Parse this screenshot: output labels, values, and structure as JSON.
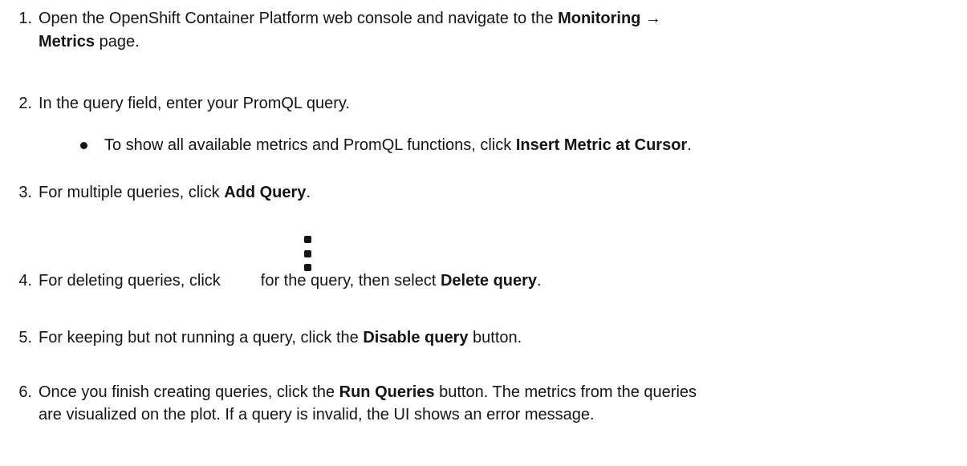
{
  "steps": [
    {
      "number": "1.",
      "pre": "Open the OpenShift Container Platform web console and navigate to the ",
      "bold": "Monitoring →",
      "line2_bold": "Metrics",
      "line2_post": " page."
    },
    {
      "number": "2.",
      "text": "In the query field, enter your PromQL query.",
      "bullet": {
        "pre": "To show all available metrics and PromQL functions, click ",
        "bold": "Insert Metric at Cursor",
        "post": "."
      }
    },
    {
      "number": "3.",
      "pre": "For multiple queries, click ",
      "bold": "Add Query",
      "post": "."
    },
    {
      "number": "4.",
      "pre": "For deleting queries, click",
      "icon": "kebab-menu-icon",
      "mid": "for the query, then select ",
      "bold": "Delete query",
      "post": "."
    },
    {
      "number": "5.",
      "pre": "For keeping but not running a query, click the ",
      "bold": "Disable query",
      "post": " button."
    },
    {
      "number": "6.",
      "pre": "Once you finish creating queries, click the ",
      "bold": "Run Queries",
      "post": " button. The metrics from the queries",
      "line2": "are visualized on the plot. If a query is invalid, the UI shows an error message."
    }
  ]
}
